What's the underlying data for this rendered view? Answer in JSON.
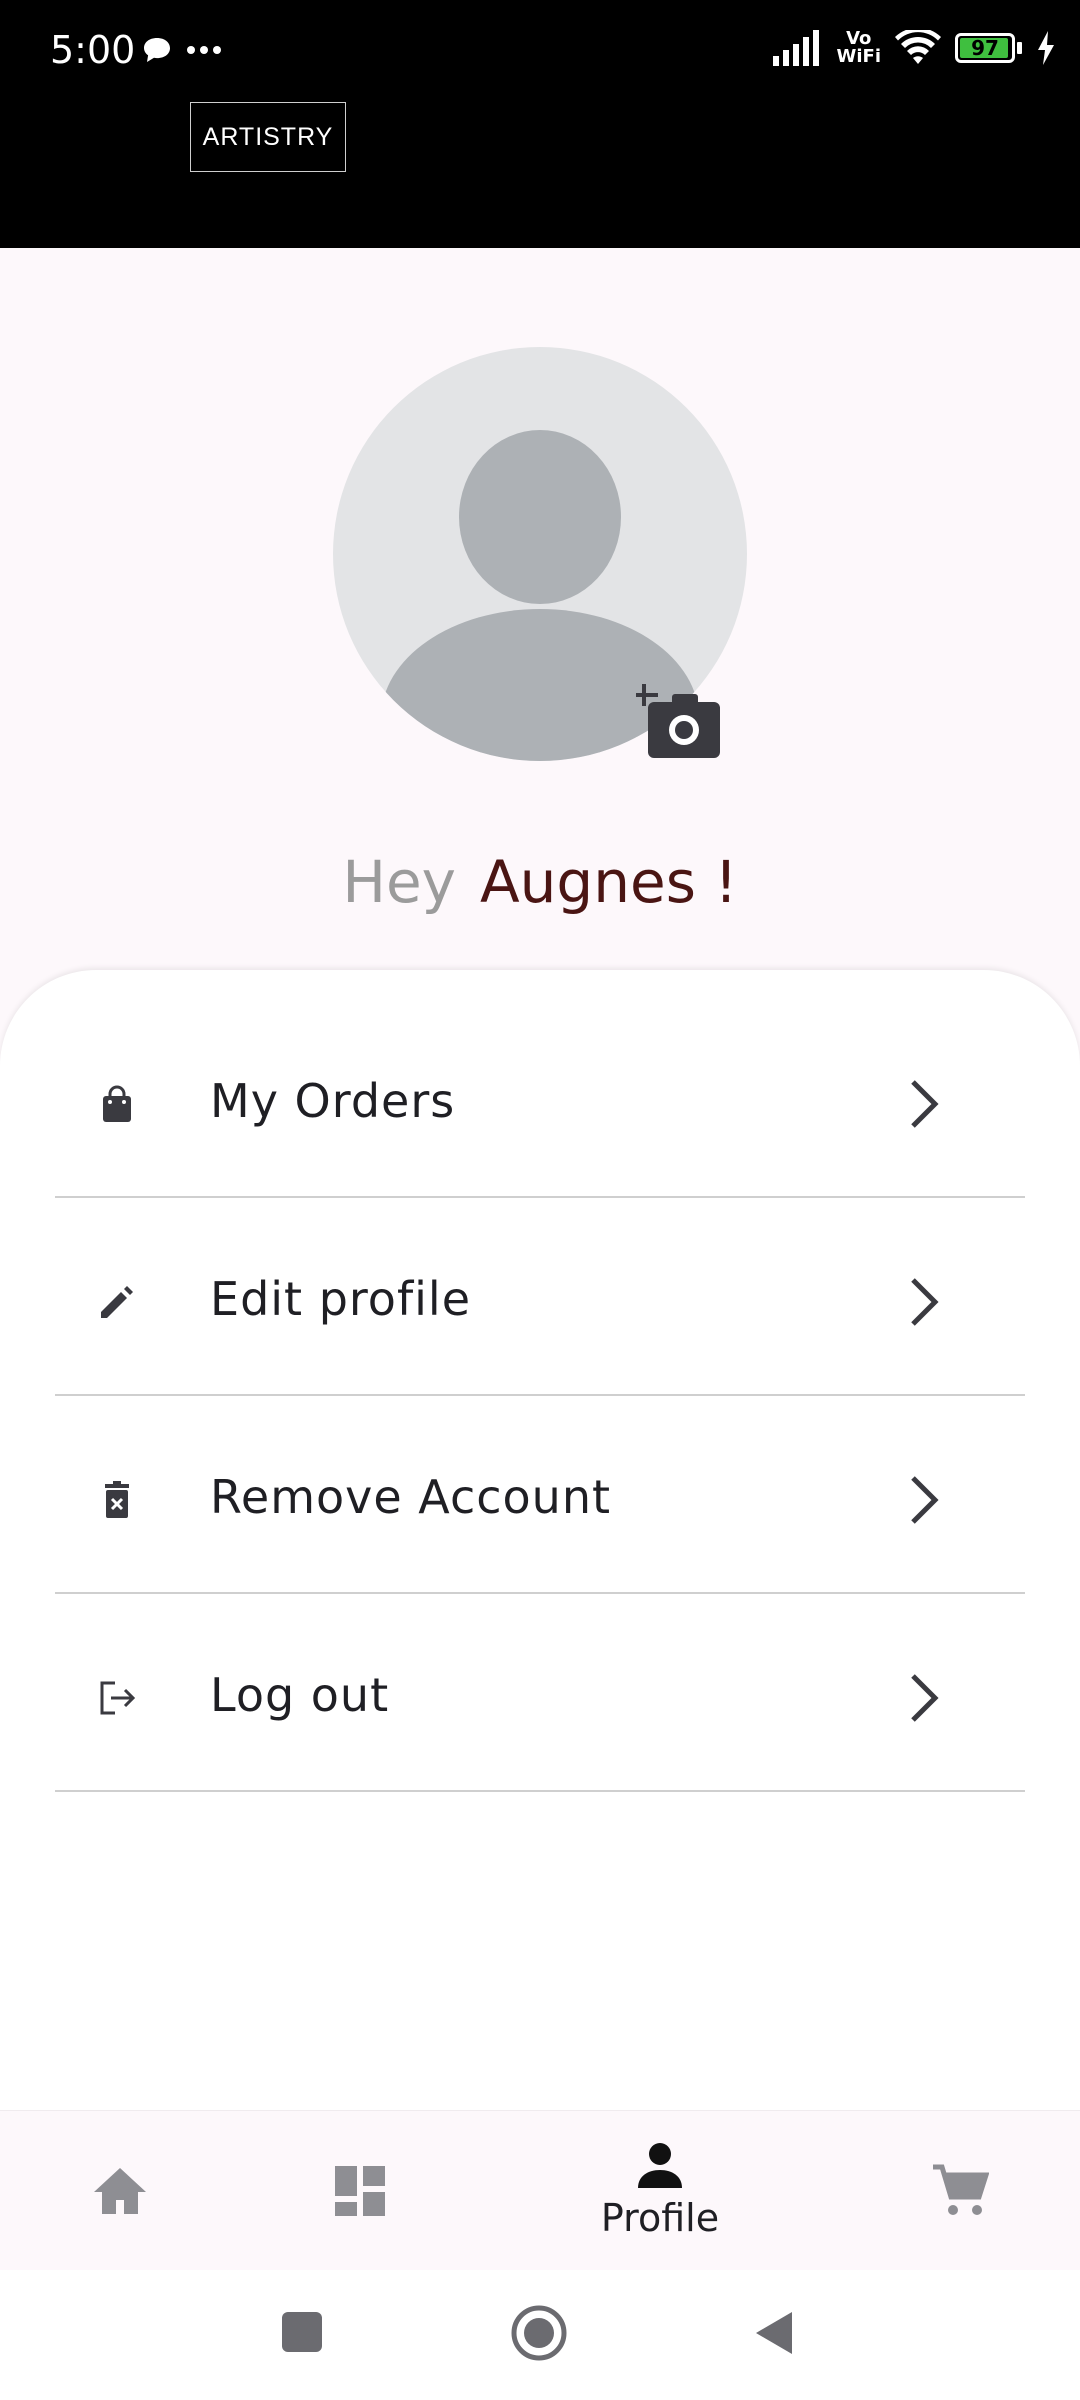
{
  "status_bar": {
    "time": "5:00",
    "network_label_top": "Vo",
    "network_label_bottom": "WiFi",
    "battery_level": "97"
  },
  "header": {
    "logo_text": "ARTISTRY"
  },
  "profile": {
    "greeting_prefix": "Hey",
    "user_name": "Augnes !"
  },
  "menu": {
    "items": [
      {
        "label": "My Orders",
        "icon": "shopping-bag-icon"
      },
      {
        "label": "Edit profile",
        "icon": "pencil-icon"
      },
      {
        "label": "Remove Account",
        "icon": "delete-icon"
      },
      {
        "label": "Log out",
        "icon": "logout-icon"
      }
    ]
  },
  "bottom_nav": {
    "items": [
      {
        "icon": "home-icon",
        "label": ""
      },
      {
        "icon": "dashboard-icon",
        "label": ""
      },
      {
        "icon": "person-icon",
        "label": "Profile",
        "active": true
      },
      {
        "icon": "cart-icon",
        "label": ""
      }
    ]
  },
  "colors": {
    "accent_name": "#4a1513",
    "icon_dark": "#3a3a40",
    "nav_icon_inactive": "#8e8e93"
  }
}
